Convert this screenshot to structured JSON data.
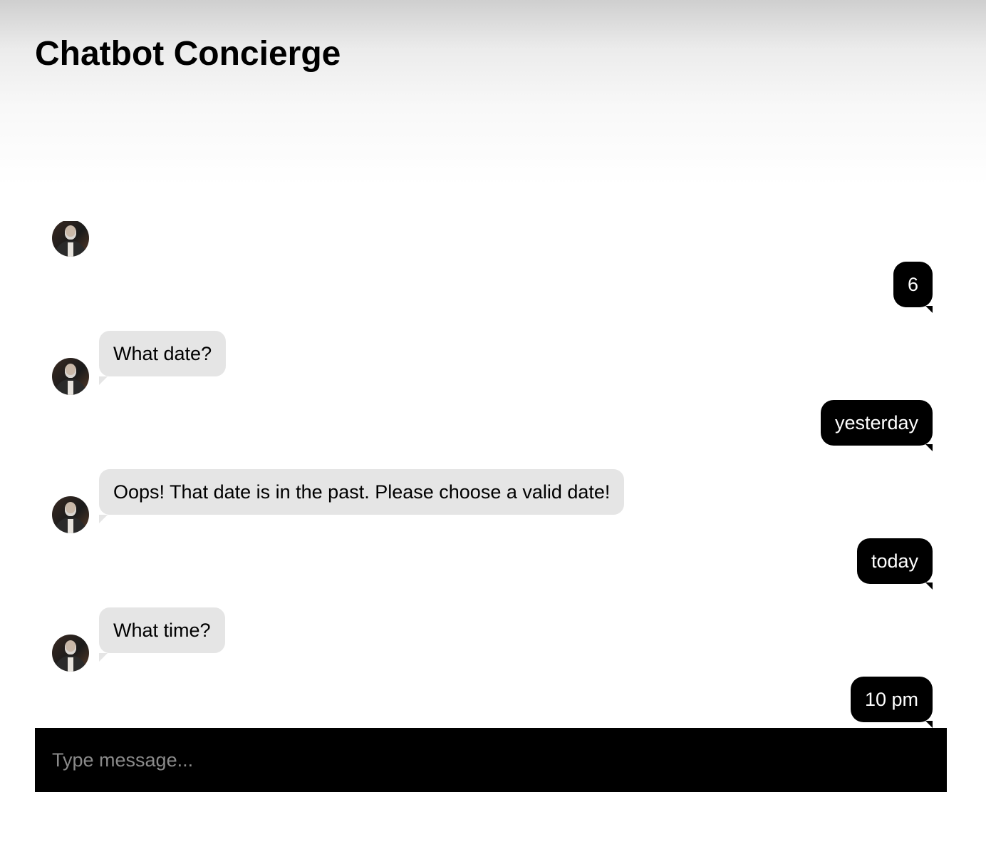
{
  "app": {
    "title": "Chatbot Concierge"
  },
  "chat": {
    "messages": [
      {
        "from": "bot",
        "text": ""
      },
      {
        "from": "user",
        "text": "6"
      },
      {
        "from": "bot",
        "text": "What date?"
      },
      {
        "from": "user",
        "text": "yesterday"
      },
      {
        "from": "bot",
        "text": "Oops! That date is in the past. Please choose a valid date!"
      },
      {
        "from": "user",
        "text": "today"
      },
      {
        "from": "bot",
        "text": "What time?"
      },
      {
        "from": "user",
        "text": "10 pm"
      },
      {
        "from": "bot",
        "text": ""
      }
    ]
  },
  "composer": {
    "placeholder": "Type message..."
  },
  "colors": {
    "user_bubble": "#000000",
    "bot_bubble": "#e5e5e5",
    "input_bar": "#000000"
  },
  "icons": {
    "bot_avatar": "bot-avatar-icon"
  }
}
